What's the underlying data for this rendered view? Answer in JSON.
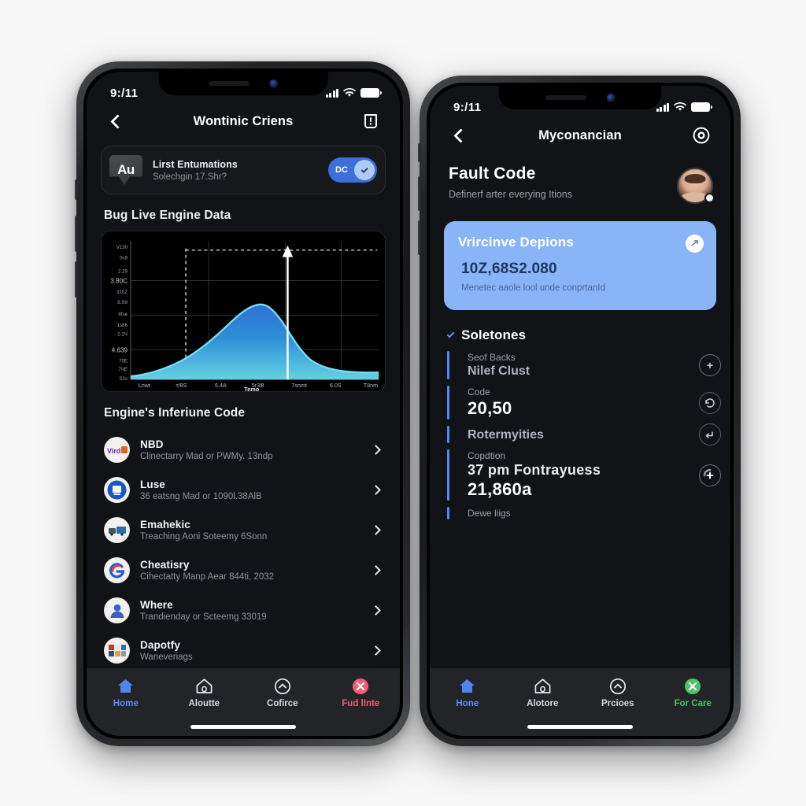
{
  "scene": {
    "background": "#f7f7f8"
  },
  "left_phone": {
    "status": {
      "time": "9:/11",
      "signal_icon": "cellular-bars-icon",
      "wifi_icon": "wifi-icon",
      "battery_icon": "battery-icon"
    },
    "nav": {
      "back_icon": "chevron-left-icon",
      "title": "Wontinic Criens",
      "right_icon": "document-alert-icon"
    },
    "banner": {
      "logo_text": "Au",
      "logo_sub": "A",
      "title": "Lirst Entumations",
      "subtitle": "Solechgin 17.Shr?",
      "toggle_label": "DC",
      "toggle_state": "on",
      "toggle_icon": "check-icon"
    },
    "chart_section_title": "Bug Live Engine Data",
    "list_section_title": "Engine's Inferiune Code",
    "rows": [
      {
        "icon": "wordmark-avatar",
        "title": "NBD",
        "subtitle": "Clinectarry Mad or PWMy. 13ndp",
        "chevron": "chevron-right-icon"
      },
      {
        "icon": "blue-badge-avatar",
        "title": "Luse",
        "subtitle": "36 eatsng Mad or 1090l.38AlB",
        "chevron": "chevron-right-icon"
      },
      {
        "icon": "truck-avatar",
        "title": "Emahekic",
        "subtitle": "Treaching Aoni Soteemy 6Sonn",
        "chevron": "chevron-right-icon"
      },
      {
        "icon": "swirl-g-avatar",
        "title": "Cheatisry",
        "subtitle": "Cihectatty Manp Aear 844ti, 2032",
        "chevron": "chevron-right-icon"
      },
      {
        "icon": "person-avatar",
        "title": "Where",
        "subtitle": "Trandienday or Scteemg 33019",
        "chevron": "chevron-right-icon"
      },
      {
        "icon": "grid-avatar",
        "title": "Dapotfy",
        "subtitle": "Waneveriags",
        "chevron": "chevron-right-icon"
      }
    ],
    "tabs": [
      {
        "label": "Home",
        "icon": "home-icon",
        "state": "active"
      },
      {
        "label": "Aloutte",
        "icon": "house-outline-icon",
        "state": "normal"
      },
      {
        "label": "Cofirce",
        "icon": "circle-arrow-icon",
        "state": "normal"
      },
      {
        "label": "Fud lInte",
        "icon": "red-alert-icon",
        "state": "danger"
      }
    ]
  },
  "right_phone": {
    "status": {
      "time": "9:/11",
      "signal_icon": "cellular-bars-icon",
      "wifi_icon": "wifi-icon",
      "battery_icon": "battery-icon"
    },
    "nav": {
      "back_icon": "chevron-left-icon",
      "title": "Myconancian",
      "right_icon": "target-circle-icon"
    },
    "header": {
      "title": "Fault Code",
      "subtitle": "Definerf arter everying Itions",
      "avatar": "user-avatar"
    },
    "card": {
      "title": "Vrircinve Depions",
      "value": "10Z,68S2.080",
      "subtitle": "Menetec aaole lool unde conprtanId",
      "badge_icon": "share-icon"
    },
    "group": {
      "chevron_icon": "chevron-down-icon",
      "title": "Soletones"
    },
    "metrics": [
      {
        "caption": "Seof Backs",
        "label": "Nilef Clust",
        "value": "",
        "action_icon": "plus-circle-icon"
      },
      {
        "caption": "Code",
        "label": "",
        "value": "20,50",
        "action_icon": "undo-circle-icon"
      },
      {
        "caption": "",
        "label": "Rotermyities",
        "value": "",
        "action_icon": "enter-circle-icon"
      },
      {
        "caption": "Copdtion",
        "label": "37 pm Fontrayuess",
        "value": "21,860a",
        "action_icon": "add-refresh-icon"
      },
      {
        "caption": "Dewe liigs",
        "label": "",
        "value": "",
        "action_icon": ""
      }
    ],
    "tabs": [
      {
        "label": "Hone",
        "icon": "home-icon",
        "state": "active"
      },
      {
        "label": "Alotore",
        "icon": "house-outline-icon",
        "state": "normal"
      },
      {
        "label": "Prcioes",
        "icon": "circle-arrow-icon",
        "state": "normal"
      },
      {
        "label": "For Care",
        "icon": "green-check-icon",
        "state": "green"
      }
    ]
  },
  "chart_data": {
    "type": "area",
    "title": "Bug Live Engine Data",
    "xlabel": "Temo",
    "ylabel": "",
    "x_ticks": [
      "Lnwt",
      "т/8S",
      "6.4A",
      "5r3l8",
      "7snmt",
      "6.0S",
      "T8nm"
    ],
    "y_ticks": [
      "V130",
      "0c8",
      "2.29",
      "3.80C",
      "310Z",
      "8.S9",
      "8fse",
      "1s86",
      "2.2Ч",
      "4.639",
      "70E",
      "7ЧE",
      "S2s"
    ],
    "grid": true,
    "legend": "none",
    "series": [
      {
        "name": "engine",
        "x": [
          0,
          5,
          10,
          15,
          20,
          25,
          30,
          35,
          40,
          45,
          50,
          55,
          60,
          65,
          70,
          75,
          80,
          85,
          90,
          95,
          100
        ],
        "values": [
          2,
          3,
          4,
          6,
          9,
          13,
          18,
          25,
          34,
          45,
          58,
          70,
          78,
          80,
          74,
          60,
          44,
          31,
          22,
          16,
          13
        ]
      }
    ],
    "annotations": [
      {
        "type": "vertical-dashed-line",
        "x": 22,
        "color": "#b9b4a4"
      },
      {
        "type": "horizontal-dashed-line",
        "y": 95,
        "color": "#b9b4a4"
      },
      {
        "type": "vertical-arrow-marker",
        "x": 62,
        "color": "#ffffff"
      }
    ],
    "area_gradient": [
      "#2b6fd6",
      "#35b6d8",
      "#5fd3e0"
    ],
    "line_color": "#6fd5ec"
  }
}
